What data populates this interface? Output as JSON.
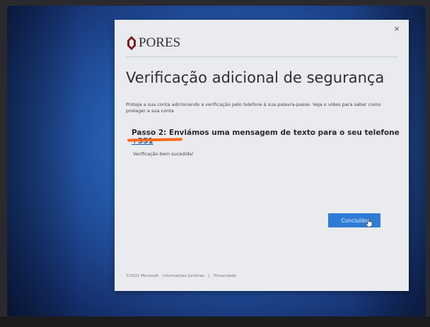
{
  "dialog": {
    "close_label": "×",
    "logo_text": "PORES",
    "title": "Verificação adicional de segurança",
    "description": "Proteja a sua conta adicionando a verificação pelo telefone à sua palavra-passe. Veja o vídeo para saber como proteger a sua conta",
    "step_text": "Passo 2: Enviámos uma mensagem de texto para o seu telefone",
    "phone": "+351",
    "success_text": "Verificação bem sucedida!",
    "done_button": "Concluído",
    "footer": {
      "copyright": "©2021 Microsoft",
      "legal": "Informações Jurídicas",
      "separator": "|",
      "privacy": "Privacidade"
    }
  },
  "colors": {
    "accent": "#2f7bd6",
    "highlight": "#ff6a1a",
    "dialog_bg": "#e9ebee"
  }
}
